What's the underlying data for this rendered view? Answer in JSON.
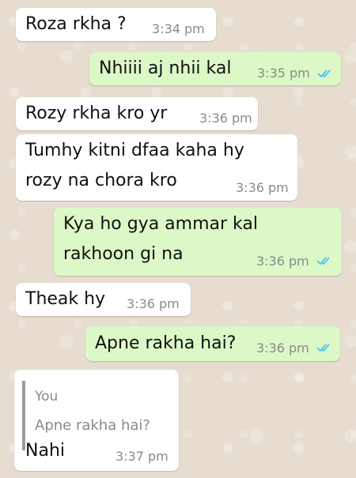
{
  "colors": {
    "incoming_bubble": "#ffffff",
    "outgoing_bubble": "#dcf8c6",
    "read_tick": "#4fc3f7",
    "timestamp": "#8a8a8a"
  },
  "messages": [
    {
      "direction": "in",
      "lines": [
        "Roza rkha ?"
      ],
      "time": "3:34 pm"
    },
    {
      "direction": "out",
      "lines": [
        "Nhiiii aj nhii kal"
      ],
      "time": "3:35 pm",
      "status_icon": "double-check-icon"
    },
    {
      "direction": "in",
      "lines": [
        "Rozy rkha kro yr"
      ],
      "time": "3:36 pm"
    },
    {
      "direction": "in",
      "lines": [
        "Tumhy kitni dfaa kaha hy",
        "rozy na chora kro"
      ],
      "time": "3:36 pm"
    },
    {
      "direction": "out",
      "lines": [
        "Kya ho gya ammar kal",
        "rakhoon gi na"
      ],
      "time": "3:36 pm",
      "status_icon": "double-check-icon"
    },
    {
      "direction": "in",
      "lines": [
        "Theak hy"
      ],
      "time": "3:36 pm"
    },
    {
      "direction": "out",
      "lines": [
        "Apne rakha hai?"
      ],
      "time": "3:36 pm",
      "status_icon": "double-check-icon"
    },
    {
      "direction": "in",
      "quote": {
        "author": "You",
        "text": "Apne rakha hai?"
      },
      "lines": [
        "Nahi"
      ],
      "time": "3:37 pm"
    }
  ]
}
